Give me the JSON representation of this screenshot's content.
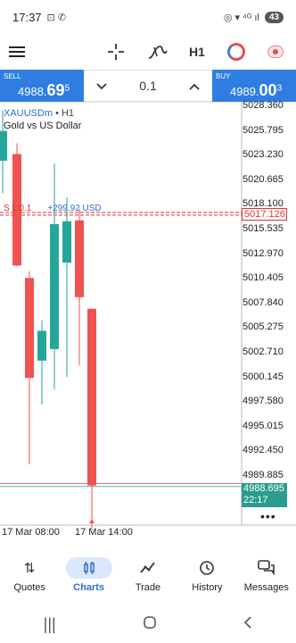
{
  "status": {
    "time": "17:37",
    "left_icons": "⊡ ✆",
    "right_icons": "◎ ▾ ⁴ᴳ ıl",
    "battery": "43"
  },
  "toolbar": {
    "timeframe": "H1"
  },
  "trade": {
    "sell_label": "SELL",
    "sell_main": "4988.",
    "sell_big": "69",
    "sell_sup": "5",
    "buy_label": "BUY",
    "buy_main": "4989.",
    "buy_big": "00",
    "buy_sup": "3",
    "lot": "0.1",
    "decrease_icon": "chevron-down-icon",
    "increase_icon": "chevron-up-icon"
  },
  "chart": {
    "symbol": "XAUUSDm",
    "timeframe_suffix": "• H1",
    "description": "Gold vs US Dollar",
    "order_line_text": "S   L 0.1",
    "order_profit": "+299.92 USD",
    "order_price_tag": "5017.126",
    "bid_tag_price": "4988.695",
    "bid_tag_countdown": "22:17",
    "more_label": "•••",
    "price_labels": [
      "5028.360",
      "5025.795",
      "5023.230",
      "5020.665",
      "5018.100",
      "5015.535",
      "5012.970",
      "5010.405",
      "5007.840",
      "5005.275",
      "5002.710",
      "5000.145",
      "4997.580",
      "4995.015",
      "4992.450",
      "4989.885"
    ],
    "time_labels": [
      "17 Mar 08:00",
      "17 Mar 14:00"
    ],
    "colors": {
      "bull": "#26a69a",
      "bear": "#ef5350",
      "order": "#d33",
      "bid": "#2a9d8f"
    }
  },
  "chart_data": {
    "type": "candlestick",
    "title": "XAUUSDm • H1",
    "subtitle": "Gold vs US Dollar",
    "ylim": [
      4988,
      5029
    ],
    "candles": [
      {
        "o": 5022.6,
        "h": 5027.8,
        "l": 5019.2,
        "c": 5025.7
      },
      {
        "o": 5023.3,
        "h": 5024.4,
        "l": 5011.6,
        "c": 5011.7
      },
      {
        "o": 5010.4,
        "h": 5011.1,
        "l": 4991.0,
        "c": 5000.0
      },
      {
        "o": 5001.8,
        "h": 5006.0,
        "l": 4997.2,
        "c": 5004.9
      },
      {
        "o": 5003.0,
        "h": 5022.3,
        "l": 4998.8,
        "c": 5016.0
      },
      {
        "o": 5012.0,
        "h": 5018.8,
        "l": 5000.1,
        "c": 5016.3
      },
      {
        "o": 5016.4,
        "h": 5017.6,
        "l": 5001.3,
        "c": 5008.4
      },
      {
        "o": 5007.2,
        "h": 5007.2,
        "l": 4984.2,
        "c": 4988.8
      }
    ],
    "order_line": 5017.126,
    "bid": 4988.695,
    "ask": 4989.003
  },
  "nav": {
    "items": [
      {
        "label": "Quotes",
        "icon": "quotes-icon"
      },
      {
        "label": "Charts",
        "icon": "charts-icon"
      },
      {
        "label": "Trade",
        "icon": "trade-icon"
      },
      {
        "label": "History",
        "icon": "history-icon"
      },
      {
        "label": "Messages",
        "icon": "messages-icon"
      }
    ]
  }
}
